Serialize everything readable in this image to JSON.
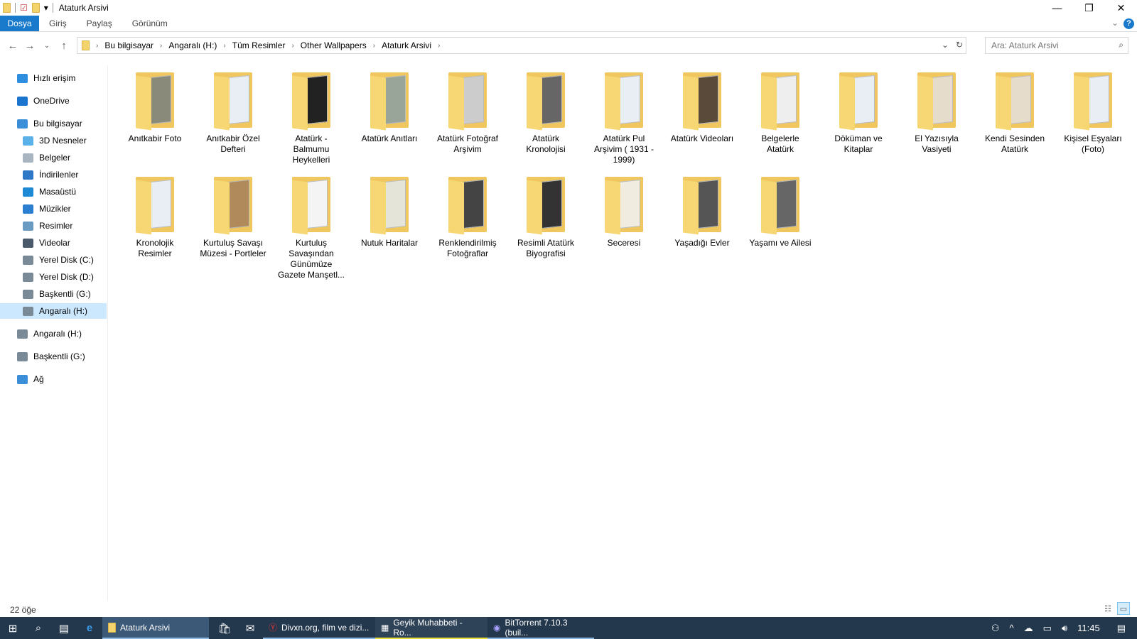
{
  "window": {
    "title": "Ataturk Arsivi",
    "minimize": "—",
    "restore": "❐",
    "close": "✕"
  },
  "ribbon": {
    "tabs": [
      "Dosya",
      "Giriş",
      "Paylaş",
      "Görünüm"
    ],
    "help": "?",
    "expand": "⌄"
  },
  "nav": {
    "back": "←",
    "forward": "→",
    "recent": "⌄",
    "up": "↑",
    "breadcrumb": [
      "Bu bilgisayar",
      "Angaralı (H:)",
      "Tüm Resimler",
      "Other Wallpapers",
      "Ataturk Arsivi"
    ],
    "dropdown": "⌄",
    "refresh": "↻",
    "search_placeholder": "Ara: Ataturk Arsivi"
  },
  "sidebar": [
    {
      "label": "Hızlı erişim",
      "icon": "star-icon",
      "color": "#2e8ee0",
      "indent": 1
    },
    {
      "label": "OneDrive",
      "icon": "cloud-icon",
      "color": "#1b75cf",
      "indent": 1
    },
    {
      "label": "Bu bilgisayar",
      "icon": "computer-icon",
      "color": "#3a8fd8",
      "indent": 1
    },
    {
      "label": "3D Nesneler",
      "icon": "cube-icon",
      "color": "#5ab2e8",
      "indent": 2
    },
    {
      "label": "Belgeler",
      "icon": "document-icon",
      "color": "#a9b6c2",
      "indent": 2
    },
    {
      "label": "İndirilenler",
      "icon": "download-icon",
      "color": "#2f78c8",
      "indent": 2
    },
    {
      "label": "Masaüstü",
      "icon": "desktop-icon",
      "color": "#1e8ad6",
      "indent": 2
    },
    {
      "label": "Müzikler",
      "icon": "music-icon",
      "color": "#2a7fd0",
      "indent": 2
    },
    {
      "label": "Resimler",
      "icon": "pictures-icon",
      "color": "#6a9bc3",
      "indent": 2
    },
    {
      "label": "Videolar",
      "icon": "video-icon",
      "color": "#4a5a6a",
      "indent": 2
    },
    {
      "label": "Yerel Disk (C:)",
      "icon": "drive-icon",
      "color": "#7a8a96",
      "indent": 2
    },
    {
      "label": "Yerel Disk (D:)",
      "icon": "drive-icon",
      "color": "#7a8a96",
      "indent": 2
    },
    {
      "label": "Başkentli (G:)",
      "icon": "drive-icon",
      "color": "#7a8a96",
      "indent": 2
    },
    {
      "label": "Angaralı (H:)",
      "icon": "drive-icon",
      "color": "#7a8a96",
      "indent": 2,
      "selected": true
    },
    {
      "label": "Angaralı (H:)",
      "icon": "drive-icon",
      "color": "#7a8a96",
      "indent": 1
    },
    {
      "label": "Başkentli (G:)",
      "icon": "drive-icon",
      "color": "#7a8a96",
      "indent": 1
    },
    {
      "label": "Ağ",
      "icon": "network-icon",
      "color": "#3a8fd8",
      "indent": 1
    }
  ],
  "folders": [
    "Anıtkabir Foto",
    "Anıtkabir Özel\nDefteri",
    "Atatürk -\nBalmumu\nHeykelleri",
    "Atatürk Anıtları",
    "Atatürk Fotoğraf\nArşivim",
    "Atatürk\nKronolojisi",
    "Atatürk Pul\nArşivim ( 1931 -\n1999)",
    "Atatürk Videoları",
    "Belgelerle\nAtatürk",
    "Döküman ve\nKitaplar",
    "El Yazısıyla\nVasiyeti",
    "Kendi Sesinden\nAtatürk",
    "Kişisel Eşyaları\n(Foto)",
    "Kronolojik\nResimler",
    "Kurtuluş Savaşı\nMüzesi - Portleler",
    "Kurtuluş\nSavaşından\nGünümüze\nGazete Manşetl...",
    "Nutuk Haritalar",
    "Renklendirilmiş\nFotoğraflar",
    "Resimli Atatürk\nBiyografisi",
    "Seceresi",
    "Yaşadığı Evler",
    "Yaşamı ve Ailesi"
  ],
  "status": {
    "count": "22 öğe"
  },
  "taskbar": {
    "apps": [
      {
        "label": "Ataturk Arsivi",
        "active": true
      },
      {
        "label": "Divxn.org, film ve dizi..."
      },
      {
        "label": "Geyik Muhabbeti - Ro..."
      },
      {
        "label": "BitTorrent 7.10.3  (buil..."
      }
    ],
    "clock": "11:45"
  }
}
